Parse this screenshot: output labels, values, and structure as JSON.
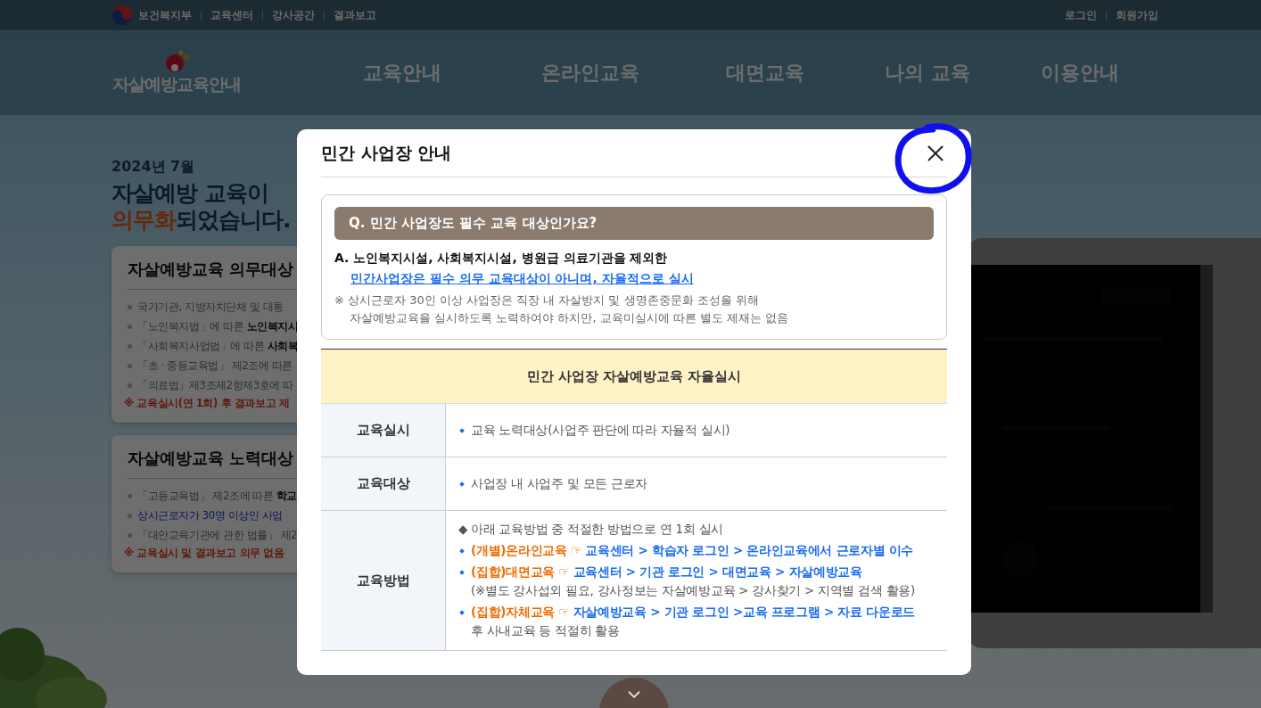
{
  "top_bar": {
    "links": [
      "보건복지부",
      "교육센터",
      "강사공간",
      "결과보고"
    ],
    "account_links": [
      "로그인",
      "회원가입"
    ]
  },
  "header": {
    "logo_text": "자살예방교육안내",
    "nav": [
      "교육안내",
      "온라인교육",
      "대면교육",
      "나의 교육",
      "이용안내"
    ]
  },
  "intro": {
    "date": "2024년 7월",
    "headline_line1": "자살예방 교육이",
    "headline_accent": "의무화",
    "headline_rest": "되었습니다."
  },
  "cards": [
    {
      "title": "자살예방교육 의무대상",
      "items": [
        {
          "kind": "plain",
          "text": "국가기관, 지방자치단체 및 대통"
        },
        {
          "kind": "plain",
          "text": "「노인복지법」에 따른 **노인복지시**"
        },
        {
          "kind": "plain",
          "text": "「사회복지사업법」에 따른 **사회복**"
        },
        {
          "kind": "plain",
          "text": "「초 · 중등교육법」 제2조에 따른"
        },
        {
          "kind": "plain",
          "text": "「의료법」제3조제2항제3호에 따"
        }
      ],
      "note": "※ 교육실시(연 1회) 후 결과보고 제"
    },
    {
      "title": "자살예방교육 노력대상",
      "items": [
        {
          "kind": "plain",
          "text": "「고등교육법」 제2조에 따른 **학교**"
        },
        {
          "kind": "highlight",
          "text": "상시근로자가 30명 이상인 사업"
        },
        {
          "kind": "plain",
          "text": "「대안교육기관에 관한 법률」 제2"
        }
      ],
      "note": "※ 교육실시 및 결과보고 의무 없음"
    }
  ],
  "modal": {
    "title": "민간 사업장 안내",
    "question": "Q. 민간 사업장도 필수 교육 대상인가요?",
    "answer": "A. 노인복지시설, 사회복지시설, 병원급 의료기관을 제외한",
    "answer_link": "민간사업장은 필수 의무 교육대상이 아니며, 자율적으로 실시",
    "notice_lines": [
      "※ 상시근로자 30인 이상 사업장은 직장 내 자살방지 및 생명존중문화 조성을 위해",
      "자살예방교육을 실시하도록 노력하여야 하지만, 교육미실시에 따른 별도 제재는 없음"
    ],
    "table": {
      "title": "민간 사업장 자살예방교육 자율실시",
      "rows": [
        {
          "label": "교육실시",
          "lines": [
            {
              "kind": "bullet",
              "text": "교육 노력대상(사업주 판단에 따라 자율적 실시)"
            }
          ]
        },
        {
          "label": "교육대상",
          "lines": [
            {
              "kind": "bullet",
              "text": "사업장 내 사업주 및 모든 근로자"
            }
          ]
        },
        {
          "label": "교육방법",
          "lines": [
            {
              "kind": "intro",
              "text": "◆ 아래 교육방법 중 적절한 방법으로 연 1회 실시"
            },
            {
              "kind": "method",
              "label": "(개별)온라인교육",
              "pointer": "☞",
              "path": "교육센터 > 학습자 로그인 > 온라인교육에서 근로자별 이수"
            },
            {
              "kind": "method",
              "label": "(집합)대면교육",
              "pointer": "☞",
              "path": "교육센터 > 기관 로그인 > 대면교육 > 자살예방교육",
              "note": "(※별도 강사섭외 필요, 강사정보는 자살예방교육 > 강사찾기 > 지역별 검색 활용)"
            },
            {
              "kind": "method",
              "label": "(집합)자체교육",
              "pointer": "☞",
              "path": "자살예방교육 > 기관 로그인 >교육 프로그램 > 자료 다운로드",
              "note": "후 사내교육 등 적절히 활용"
            }
          ]
        }
      ]
    }
  }
}
